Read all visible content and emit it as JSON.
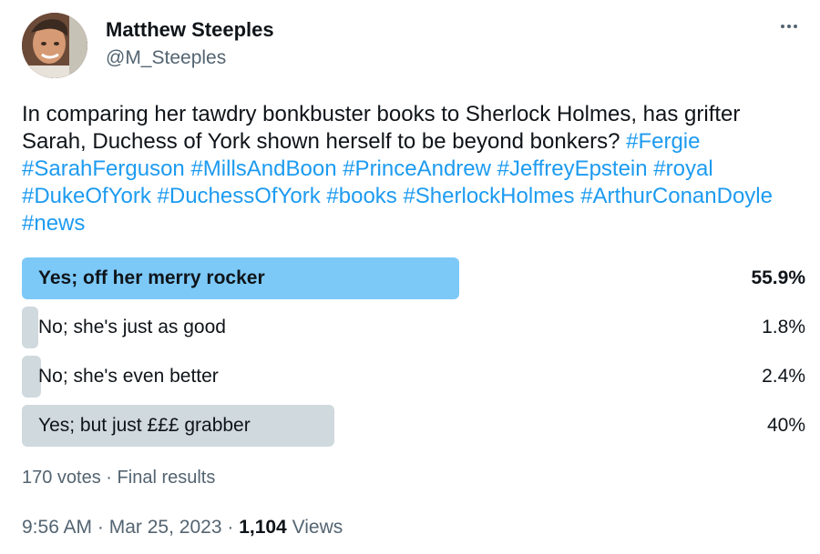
{
  "author": {
    "display_name": "Matthew Steeples",
    "handle": "@M_Steeples"
  },
  "tweet": {
    "text": "In comparing her tawdry bonkbuster books to Sherlock Holmes, has grifter Sarah, Duchess of York shown herself to be beyond bonkers?",
    "hashtags": "#Fergie #SarahFerguson #MillsAndBoon #PrinceAndrew #JeffreyEpstein #royal #DukeOfYork #DuchessOfYork #books #SherlockHolmes #ArthurConanDoyle #news"
  },
  "poll": {
    "options": [
      {
        "label": "Yes; off her merry rocker",
        "percent": "55.9%",
        "fraction": 0.559,
        "winner": true
      },
      {
        "label": "No; she's just as good",
        "percent": "1.8%",
        "fraction": 0.018,
        "winner": false
      },
      {
        "label": "No; she's even better",
        "percent": "2.4%",
        "fraction": 0.024,
        "winner": false
      },
      {
        "label": "Yes; but just £££ grabber",
        "percent": "40%",
        "fraction": 0.4,
        "winner": false
      }
    ],
    "votes_text": "170 votes",
    "separator": "·",
    "status": "Final results"
  },
  "meta": {
    "time": "9:56 AM",
    "separator": "·",
    "date": "Mar 25, 2023",
    "views_count": "1,104",
    "views_label": "Views"
  },
  "icons": {
    "more": "more-horizontal-icon"
  },
  "colors": {
    "link": "#1d9bf0",
    "winner_bar": "#7cc9f8",
    "bar": "#cfd9de",
    "secondary_text": "#536471"
  }
}
